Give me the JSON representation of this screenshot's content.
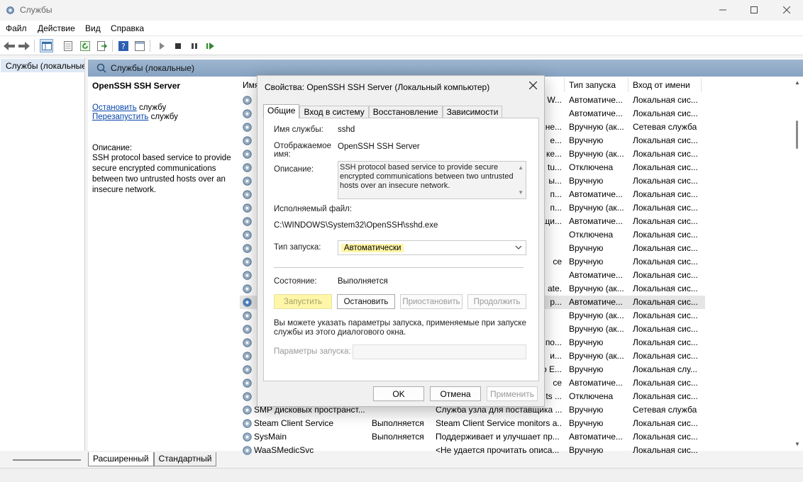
{
  "window": {
    "title": "Службы"
  },
  "menu": [
    "Файл",
    "Действие",
    "Вид",
    "Справка"
  ],
  "tree": {
    "item": "Службы (локальные)"
  },
  "content": {
    "header": "Службы (локальные)",
    "service_name": "OpenSSH SSH Server",
    "stop_link": "Остановить",
    "stop_suffix": " службу",
    "restart_link": "Перезапустить",
    "restart_suffix": " службу",
    "description_label": "Описание:",
    "description": "SSH protocol based service to provide secure encrypted communications between two untrusted hosts over an insecure network."
  },
  "columns": {
    "name": "Имя",
    "startup": "Тип запуска",
    "logon": "Вход от имени"
  },
  "rows": [
    {
      "name": "",
      "status": "",
      "desc": "W...",
      "startup": "Автоматиче...",
      "logon": "Локальная сис..."
    },
    {
      "name": "",
      "status": "",
      "desc": "",
      "startup": "Автоматиче...",
      "logon": "Локальная сис..."
    },
    {
      "name": "",
      "status": "",
      "desc": "не...",
      "startup": "Вручную (ак...",
      "logon": "Сетевая служба"
    },
    {
      "name": "",
      "status": "",
      "desc": "е...",
      "startup": "Вручную",
      "logon": "Локальная сис..."
    },
    {
      "name": "",
      "status": "",
      "desc": "ке...",
      "startup": "Вручную (ак...",
      "logon": "Локальная сис..."
    },
    {
      "name": "",
      "status": "",
      "desc": "tu...",
      "startup": "Отключена",
      "logon": "Локальная сис..."
    },
    {
      "name": "",
      "status": "",
      "desc": "ы...",
      "startup": "Вручную",
      "logon": "Локальная сис..."
    },
    {
      "name": "",
      "status": "",
      "desc": "п...",
      "startup": "Автоматиче...",
      "logon": "Локальная сис..."
    },
    {
      "name": "",
      "status": "",
      "desc": "п...",
      "startup": "Вручную (ак...",
      "logon": "Локальная сис..."
    },
    {
      "name": "",
      "status": "",
      "desc": "щи...",
      "startup": "Автоматиче...",
      "logon": "Локальная сис..."
    },
    {
      "name": "",
      "status": "",
      "desc": "",
      "startup": "Отключена",
      "logon": "Локальная сис..."
    },
    {
      "name": "",
      "status": "",
      "desc": "",
      "startup": "Вручную",
      "logon": "Локальная сис..."
    },
    {
      "name": "",
      "status": "",
      "desc": "се",
      "startup": "Вручную",
      "logon": "Локальная сис..."
    },
    {
      "name": "",
      "status": "",
      "desc": "",
      "startup": "Автоматиче...",
      "logon": "Локальная сис..."
    },
    {
      "name": "",
      "status": "",
      "desc": "ate.",
      "startup": "Вручную (ак...",
      "logon": "Локальная сис..."
    },
    {
      "name": "",
      "status": "",
      "desc": "p...",
      "startup": "Автоматиче...",
      "logon": "Локальная сис..."
    },
    {
      "name": "",
      "status": "",
      "desc": "",
      "startup": "Вручную (ак...",
      "logon": "Локальная сис..."
    },
    {
      "name": "",
      "status": "",
      "desc": "",
      "startup": "Вручную (ак...",
      "logon": "Локальная сис..."
    },
    {
      "name": "",
      "status": "",
      "desc": "по...",
      "startup": "Вручную",
      "logon": "Локальная сис..."
    },
    {
      "name": "",
      "status": "",
      "desc": "и...",
      "startup": "Вручную (ак...",
      "logon": "Локальная сис..."
    },
    {
      "name": "",
      "status": "",
      "desc": "о E...",
      "startup": "Вручную",
      "logon": "Локальная слу..."
    },
    {
      "name": "",
      "status": "",
      "desc": "се",
      "startup": "Автоматиче...",
      "logon": "Локальная сис..."
    },
    {
      "name": "",
      "status": "",
      "desc": "ts ...",
      "startup": "Отключена",
      "logon": "Локальная сис..."
    },
    {
      "name": "SMP дисковых пространст...",
      "status": "",
      "desc": "Служба узла для поставщика ...",
      "startup": "Вручную",
      "logon": "Сетевая служба"
    },
    {
      "name": "Steam Client Service",
      "status": "Выполняется",
      "desc": "Steam Client Service monitors a...",
      "startup": "Вручную",
      "logon": "Локальная сис..."
    },
    {
      "name": "SysMain",
      "status": "Выполняется",
      "desc": "Поддерживает и улучшает пр...",
      "startup": "Автоматиче...",
      "logon": "Локальная сис..."
    },
    {
      "name": "WaaSMedicSvc",
      "status": "",
      "desc": "<Не удается прочитать описа...",
      "startup": "Вручную",
      "logon": "Локальная сис..."
    }
  ],
  "bottom_tabs": {
    "extended": "Расширенный",
    "standard": "Стандартный"
  },
  "dialog": {
    "title": "Свойства: OpenSSH SSH Server (Локальный компьютер)",
    "tabs": [
      "Общие",
      "Вход в систему",
      "Восстановление",
      "Зависимости"
    ],
    "service_name_label": "Имя службы:",
    "service_name_value": "sshd",
    "display_name_label_1": "Отображаемое",
    "display_name_label_2": "имя:",
    "display_name_value": "OpenSSH SSH Server",
    "description_label": "Описание:",
    "description_value": "SSH protocol based service to provide secure encrypted communications between two untrusted hosts over an insecure network.",
    "exe_label": "Исполняемый файл:",
    "exe_value": "C:\\WINDOWS\\System32\\OpenSSH\\sshd.exe",
    "startup_label": "Тип запуска:",
    "startup_value": "Автоматически",
    "state_label": "Состояние:",
    "state_value": "Выполняется",
    "btn_start": "Запустить",
    "btn_stop": "Остановить",
    "btn_pause": "Приостановить",
    "btn_resume": "Продолжить",
    "hint_line_1": "Вы можете указать параметры запуска, применяемые при запуске",
    "hint_line_2": "службы из этого диалогового окна.",
    "params_label": "Параметры запуска:",
    "params_value": "",
    "ok": "OK",
    "cancel": "Отмена",
    "apply": "Применить"
  }
}
